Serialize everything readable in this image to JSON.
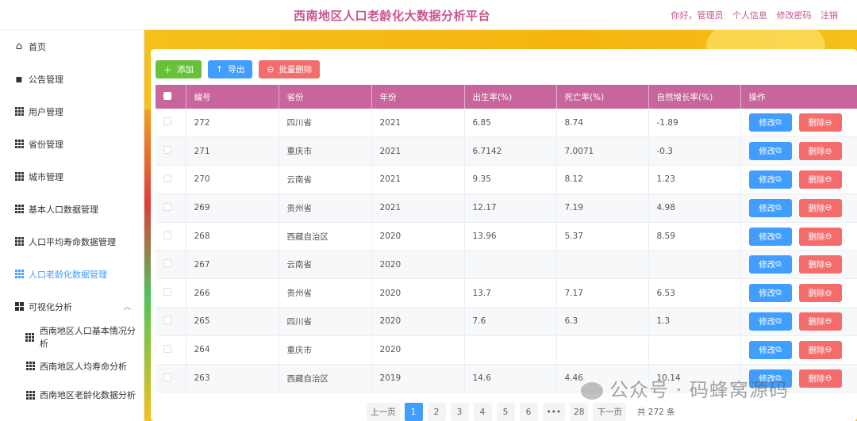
{
  "header": {
    "title": "西南地区人口老龄化大数据分析平台",
    "greeting": "你好，管理员",
    "profile": "个人信息",
    "change_password": "修改密码",
    "logout": "注销"
  },
  "sidebar": {
    "items": [
      {
        "label": "首页",
        "icon": "home-icon"
      },
      {
        "label": "公告管理",
        "icon": "message-icon"
      },
      {
        "label": "用户管理",
        "icon": "grid-icon"
      },
      {
        "label": "省份管理",
        "icon": "grid-icon"
      },
      {
        "label": "城市管理",
        "icon": "grid-icon"
      },
      {
        "label": "基本人口数据管理",
        "icon": "grid-icon"
      },
      {
        "label": "人口平均寿命数据管理",
        "icon": "grid-icon"
      },
      {
        "label": "人口老龄化数据管理",
        "icon": "grid-icon",
        "active": true
      },
      {
        "label": "可视化分析",
        "icon": "dashboard-icon",
        "expanded": true
      },
      {
        "label": "西南地区人口基本情况分析",
        "icon": "grid-icon",
        "sub": true
      },
      {
        "label": "西南地区人均寿命分析",
        "icon": "grid-icon",
        "sub": true
      },
      {
        "label": "西南地区老龄化数据分析",
        "icon": "grid-icon",
        "sub": true
      }
    ]
  },
  "toolbar": {
    "add": "添加",
    "export": "导出",
    "batch_delete": "批量删除"
  },
  "table": {
    "columns": [
      "编号",
      "省份",
      "年份",
      "出生率(%)",
      "死亡率(%)",
      "自然增长率(%)",
      "操作"
    ],
    "rows": [
      [
        "272",
        "四川省",
        "2021",
        "6.85",
        "8.74",
        "-1.89"
      ],
      [
        "271",
        "重庆市",
        "2021",
        "6.7142",
        "7.0071",
        "-0.3"
      ],
      [
        "270",
        "云南省",
        "2021",
        "9.35",
        "8.12",
        "1.23"
      ],
      [
        "269",
        "贵州省",
        "2021",
        "12.17",
        "7.19",
        "4.98"
      ],
      [
        "268",
        "西藏自治区",
        "2020",
        "13.96",
        "5.37",
        "8.59"
      ],
      [
        "267",
        "云南省",
        "2020",
        "",
        "",
        ""
      ],
      [
        "266",
        "贵州省",
        "2020",
        "13.7",
        "7.17",
        "6.53"
      ],
      [
        "265",
        "四川省",
        "2020",
        "7.6",
        "6.3",
        "1.3"
      ],
      [
        "264",
        "重庆市",
        "2020",
        "",
        "",
        ""
      ],
      [
        "263",
        "西藏自治区",
        "2019",
        "14.6",
        "4.46",
        "10.14"
      ]
    ],
    "edit_label": "修改",
    "delete_label": "删除"
  },
  "pager": {
    "prev": "上一页",
    "pages": [
      "1",
      "2",
      "3",
      "4",
      "5",
      "6",
      "•••",
      "28"
    ],
    "current": "1",
    "next": "下一页",
    "total": "共 272 条"
  },
  "watermark": "公众号 · 码蜂窝源码"
}
